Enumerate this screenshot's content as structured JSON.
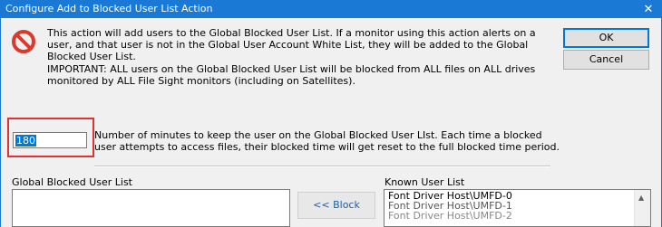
{
  "window": {
    "title": "Configure Add to Blocked User List Action",
    "close_glyph": "✕"
  },
  "icon": {
    "name": "prohibited-icon",
    "color": "#d93a2b"
  },
  "description": "This action will add users to the Global Blocked User List.  If a monitor using this action alerts on a user, and that user is not in the Global User Account White List, they will be added to the Global Blocked User List.",
  "important": "IMPORTANT: ALL users on the Global Blocked User List will be blocked from ALL files on ALL drives monitored by ALL File Sight monitors (including on Satellites).",
  "buttons": {
    "ok": "OK",
    "cancel": "Cancel",
    "block": "<< Block"
  },
  "minutes": {
    "value": "180",
    "description": "Number of minutes to keep the user on the Global Blocked User LIst.  Each time a blocked user attempts to access files, their blocked time will get reset to the full blocked time period."
  },
  "global_list": {
    "label": "Global Blocked User List",
    "items": []
  },
  "known_list": {
    "label": "Known User List",
    "items": [
      "Font Driver Host\\UMFD-0",
      "Font Driver Host\\UMFD-1",
      "Font Driver Host\\UMFD-2"
    ]
  },
  "colors": {
    "titlebar": "#1b79d6",
    "highlight_box": "#e63030"
  }
}
